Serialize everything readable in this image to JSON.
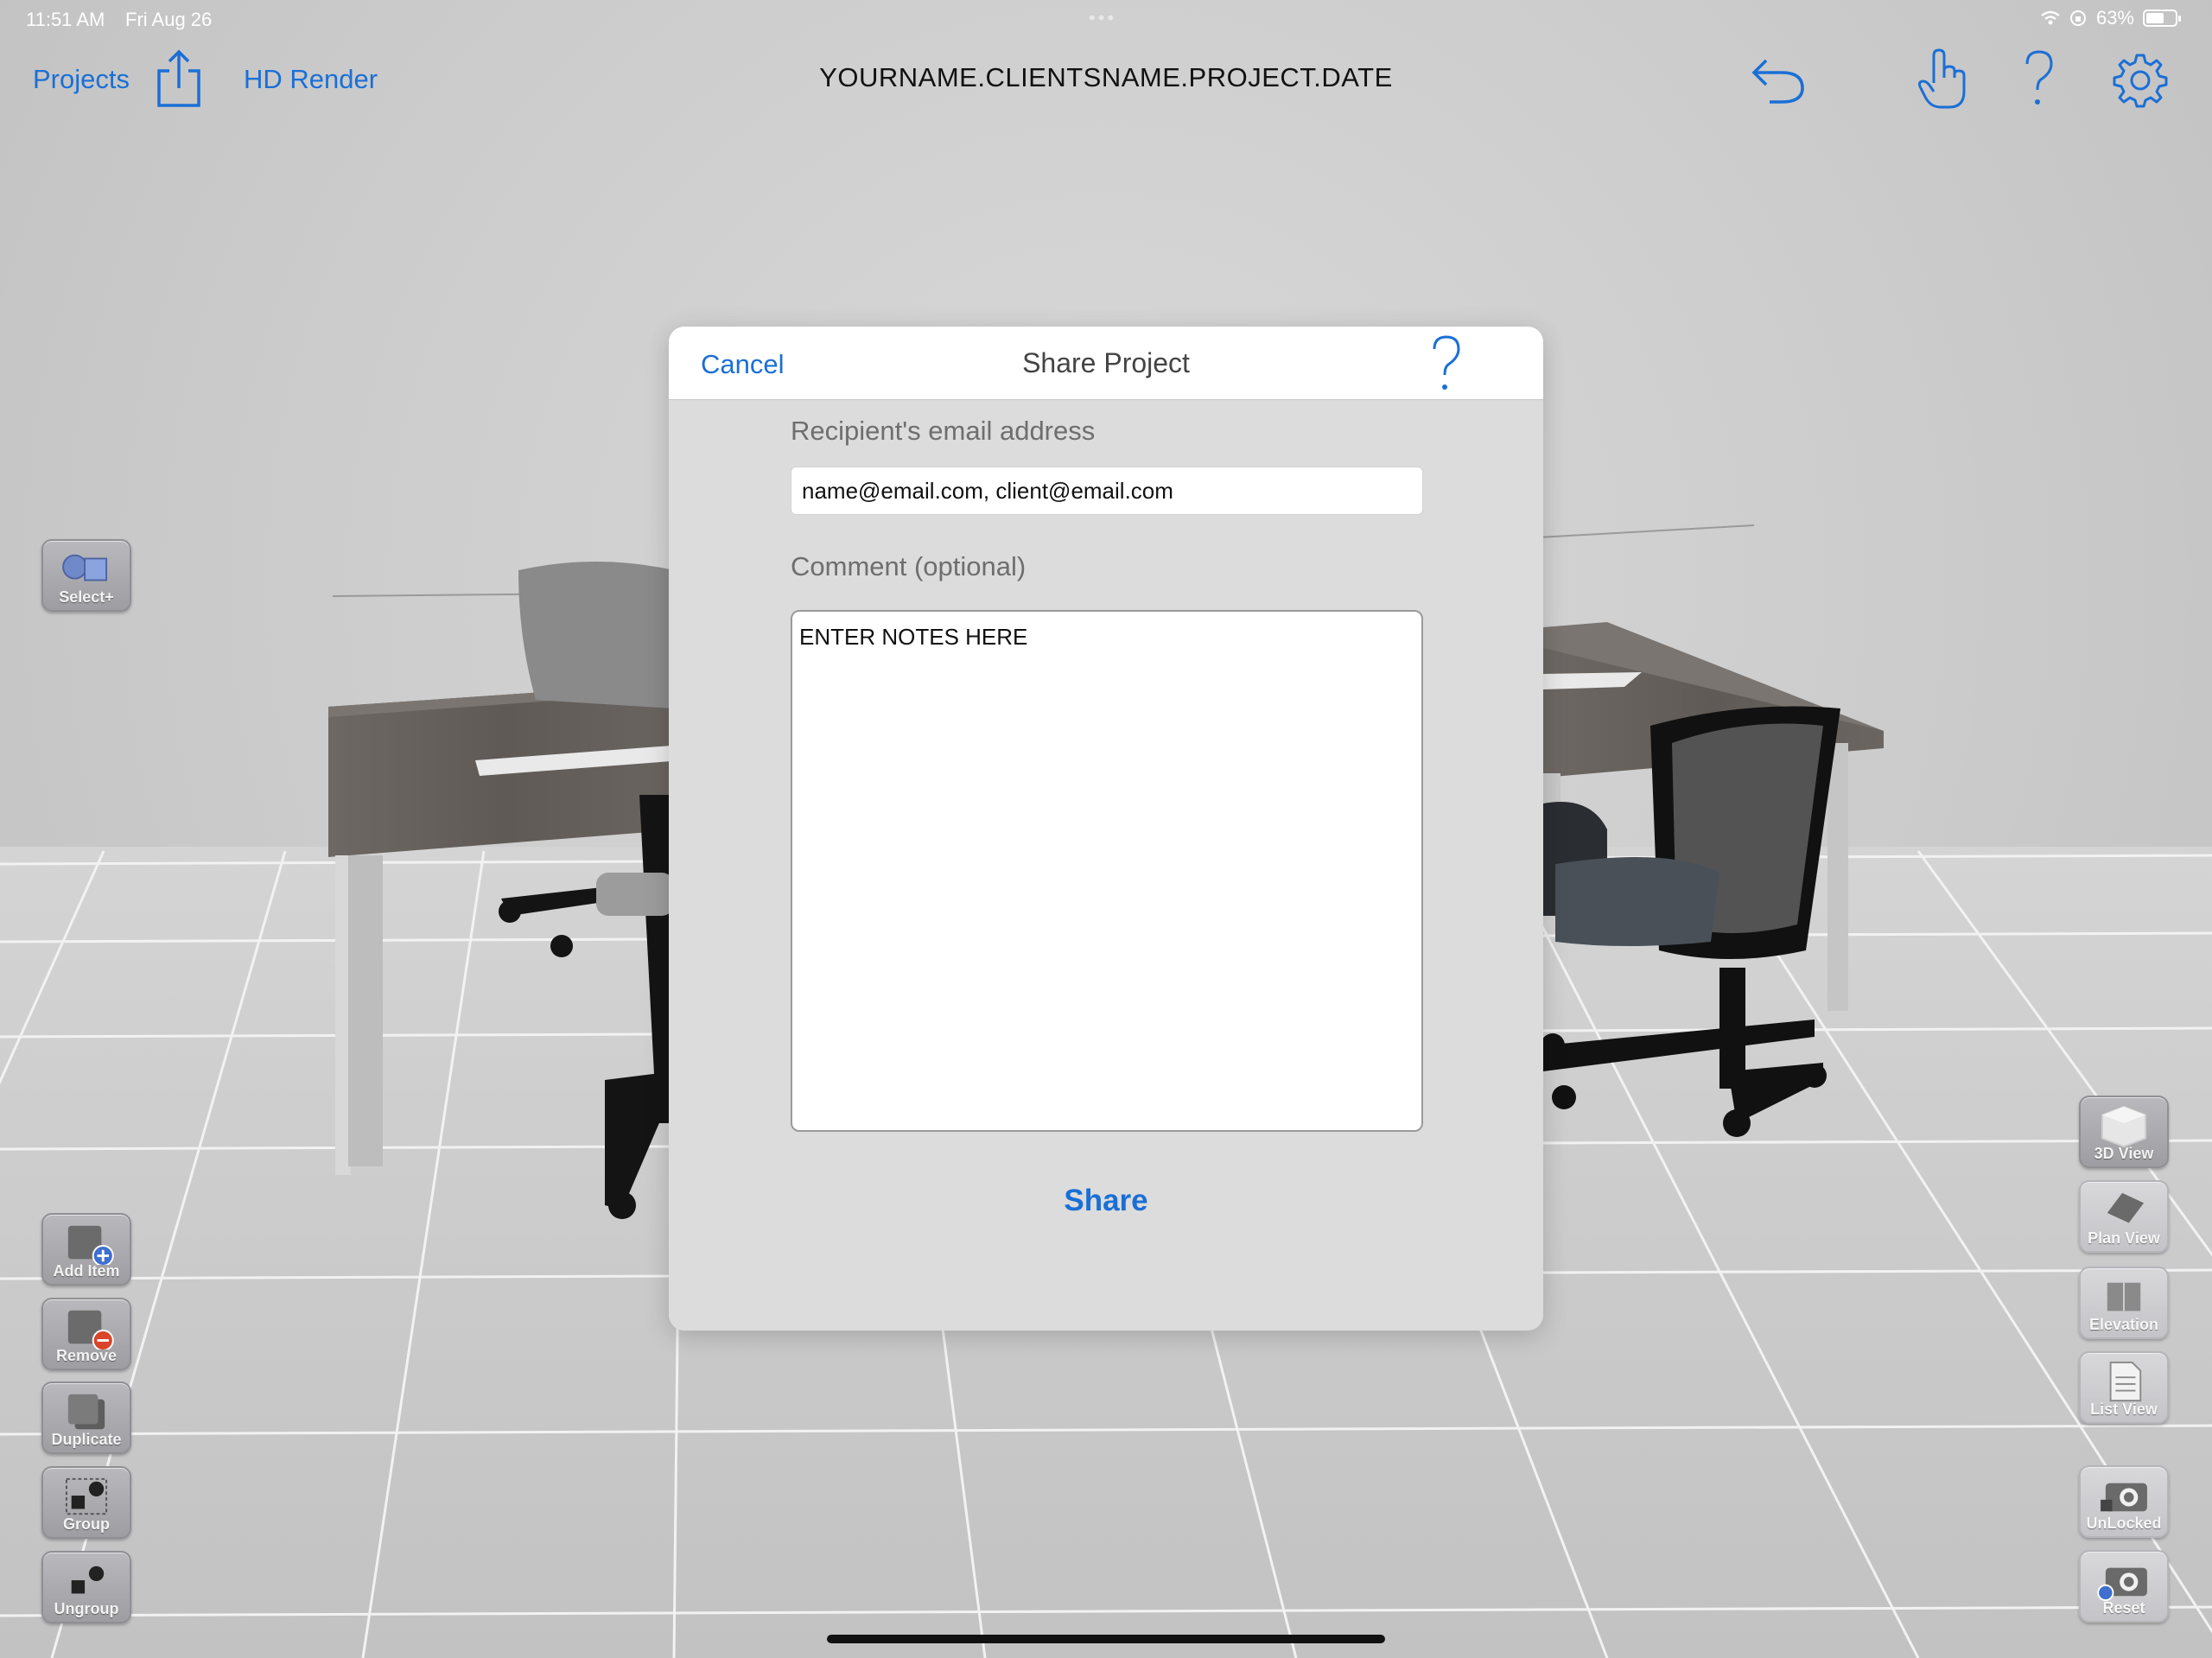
{
  "status_bar": {
    "time": "11:51 AM",
    "date": "Fri Aug 26",
    "battery_percent": "63%",
    "battery_level": 0.63
  },
  "nav": {
    "projects_label": "Projects",
    "hd_render_label": "HD Render",
    "title": "YOURNAME.CLIENTSNAME.PROJECT.DATE",
    "icons": [
      "share-icon",
      "undo-icon",
      "hand-pointer-icon",
      "help-icon",
      "gear-icon"
    ]
  },
  "left_tools": {
    "select_plus": "Select+",
    "add_item": "Add Item",
    "remove": "Remove",
    "duplicate": "Duplicate",
    "group": "Group",
    "ungroup": "Ungroup"
  },
  "right_tools": {
    "view_3d": "3D View",
    "plan_view": "Plan View",
    "elevation": "Elevation",
    "list_view": "List View",
    "unlocked": "UnLocked",
    "reset": "Reset"
  },
  "dialog": {
    "cancel_label": "Cancel",
    "title": "Share Project",
    "email_label": "Recipient's email address",
    "email_value": "name@email.com, client@email.com",
    "comment_label": "Comment (optional)",
    "comment_value": "ENTER NOTES HERE",
    "share_label": "Share"
  },
  "colors": {
    "accent": "#1a6fd6",
    "scene_bg": "#cfcfcf",
    "modal_bg": "#dcdcdc"
  }
}
